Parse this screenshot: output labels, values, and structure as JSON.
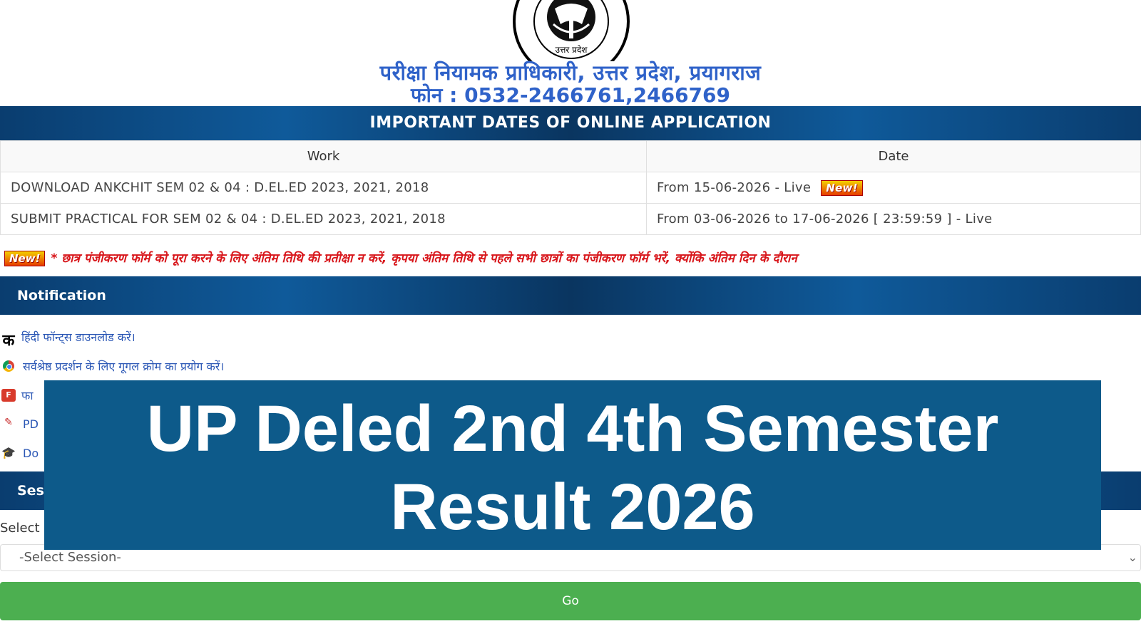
{
  "header": {
    "org_title": "परीक्षा नियामक प्राधिकारी, उत्तर प्रदेश, प्रयागराज",
    "phone_label": "फोन : ",
    "phone_numbers": "0532-2466761,2466769",
    "emblem_text": "उत्तर प्रदेश"
  },
  "dates_section": {
    "title": "IMPORTANT DATES OF ONLINE APPLICATION",
    "columns": [
      "Work",
      "Date"
    ],
    "rows": [
      {
        "work": "DOWNLOAD ANKCHIT SEM 02 & 04 : D.EL.ED 2023, 2021, 2018",
        "date": "From 15-06-2026 - Live",
        "badge": "New!"
      },
      {
        "work": "SUBMIT PRACTICAL FOR SEM 02 & 04 : D.EL.ED 2023, 2021, 2018",
        "date": "From 03-06-2026 to 17-06-2026 [ 23:59:59 ] - Live"
      }
    ]
  },
  "marquee": {
    "badge": "New!",
    "text": "* छात्र पंजीकरण फॉर्म को पूरा करने के लिए अंतिम तिथि की प्रतीक्षा न करें, कृपया अंतिम तिथि से पहले सभी छात्रों का पंजीकरण फॉर्म भरें, क्योंकि अंतिम दिन के दौरान"
  },
  "notification": {
    "title": "Notification",
    "items": [
      {
        "icon": "ka-icon",
        "glyph": "क",
        "text": "हिंदी फॉन्ट्स डाउनलोड करें।"
      },
      {
        "icon": "chrome-icon",
        "text": "सर्वश्रेष्ठ प्रदर्शन के लिए गूगल क्रोम का प्रयोग करें।"
      },
      {
        "icon": "filezilla-icon",
        "glyph": "F",
        "text": "फा"
      },
      {
        "icon": "pdf-icon",
        "glyph": "✎",
        "text": "PD"
      },
      {
        "icon": "graduation-cap-icon",
        "glyph": "🎓",
        "text": "Do"
      }
    ]
  },
  "session": {
    "title": "Ses",
    "label": "Select",
    "select_value": "-Select Session-",
    "go_label": "Go"
  },
  "overlay": {
    "line1": "UP Deled 2nd 4th Semester",
    "line2": "Result 2026"
  },
  "colors": {
    "band": "#0a3d6f",
    "org_text": "#2f62c9",
    "marquee_text": "#d8161b",
    "go_button": "#4caf50",
    "overlay": "#0d5a8a"
  }
}
